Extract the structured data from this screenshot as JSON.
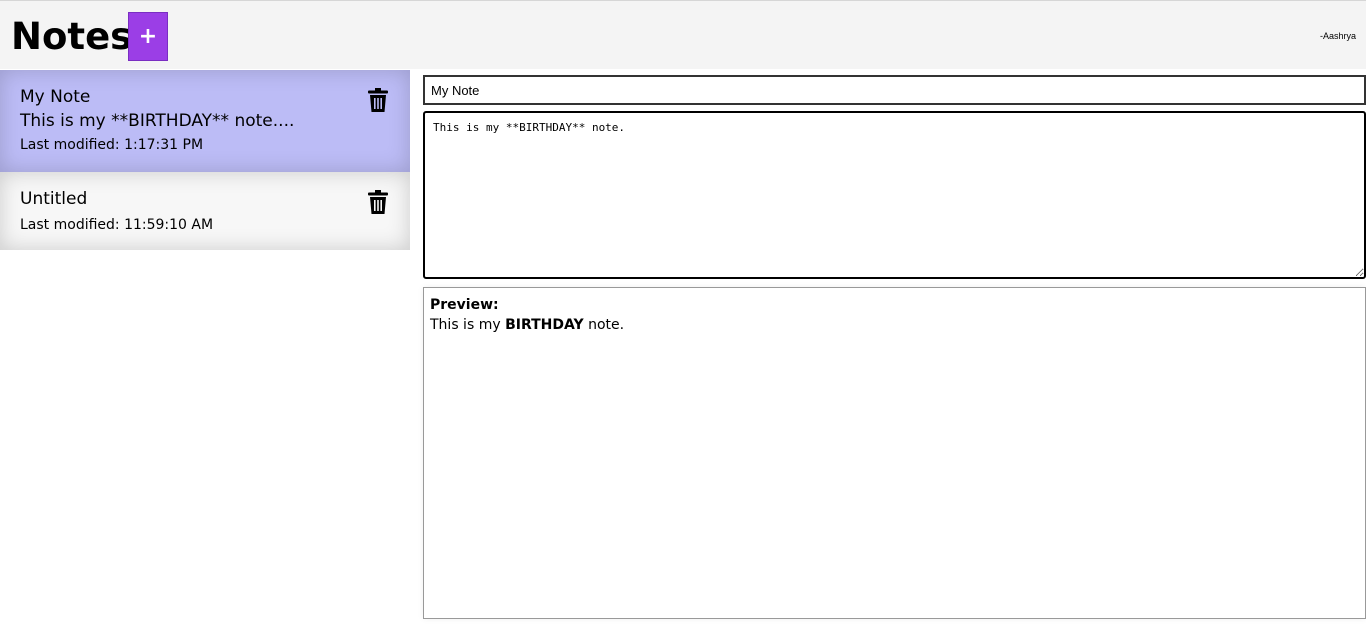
{
  "header": {
    "title": "Notes",
    "add_label": "+",
    "author": "-Aashrya"
  },
  "notes": [
    {
      "title": "My Note",
      "preview": "This is my **BIRTHDAY** note....",
      "modified": "Last modified: 1:17:31 PM",
      "selected": true
    },
    {
      "title": "Untitled",
      "modified": "Last modified: 11:59:10 AM",
      "selected": false
    }
  ],
  "editor": {
    "title_value": "My Note",
    "body_value": "This is my **BIRTHDAY** note."
  },
  "preview": {
    "label": "Preview:",
    "prefix": "This is my ",
    "bold": "BIRTHDAY",
    "suffix": " note."
  },
  "colors": {
    "accent": "#9b3ee6",
    "selected_card": "#bcbcf6",
    "header_bg": "#f4f4f4"
  }
}
